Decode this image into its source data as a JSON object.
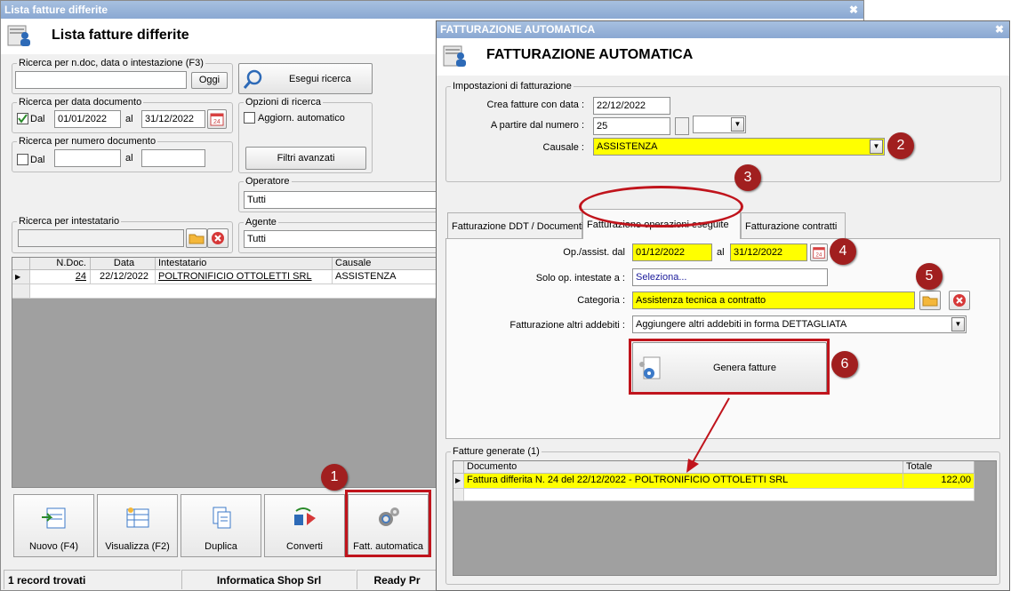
{
  "main": {
    "window_title": "Lista fatture differite",
    "page_title": "Lista fatture differite",
    "search_group": {
      "label": "Ricerca per n.doc, data o intestazione (F3)",
      "value": "",
      "ogg_label": "Oggi"
    },
    "search_button": "Esegui ricerca",
    "date_group": {
      "label": "Ricerca per data documento",
      "dal_label": "Dal",
      "from": "01/01/2022",
      "al_label": "al",
      "to": "31/12/2022",
      "checked": true
    },
    "number_group": {
      "label": "Ricerca per numero documento",
      "dal_label": "Dal",
      "al_label": "al",
      "from": "",
      "to": "",
      "checked": false
    },
    "options_group": {
      "label": "Opzioni di ricerca",
      "auto_update": "Aggiorn. automatico",
      "advanced_filters": "Filtri avanzati"
    },
    "operator": {
      "label": "Operatore",
      "value": "Tutti"
    },
    "agent": {
      "label": "Agente",
      "value": "Tutti"
    },
    "holder": {
      "label": "Ricerca per intestatario",
      "value": ""
    },
    "table": {
      "columns": [
        "N.Doc.",
        "Data",
        "Intestatario",
        "Causale"
      ],
      "rows": [
        {
          "ndoc": "24",
          "date": "22/12/2022",
          "holder": "POLTRONIFICIO OTTOLETTI SRL",
          "causale": "ASSISTENZA"
        }
      ]
    },
    "toolbar": {
      "new": "Nuovo (F4)",
      "view": "Visualizza (F2)",
      "duplicate": "Duplica",
      "convert": "Converti",
      "auto_invoice": "Fatt. automatica"
    },
    "status": {
      "records": "1 record trovati",
      "company": "Informatica Shop Srl",
      "ready": "Ready Pr"
    }
  },
  "dialog": {
    "window_title": "FATTURAZIONE AUTOMATICA",
    "page_title": "FATTURAZIONE AUTOMATICA",
    "settings_group": "Impostazioni di fatturazione",
    "create_date": {
      "label": "Crea fatture con data :",
      "value": "22/12/2022"
    },
    "start_number": {
      "label": "A partire dal numero :",
      "value": "25",
      "suffix": ""
    },
    "causale": {
      "label": "Causale :",
      "value": "ASSISTENZA"
    },
    "tabs": [
      {
        "label": "Fatturazione DDT / Documenti"
      },
      {
        "label": "Fatturazione operazioni eseguite"
      },
      {
        "label": "Fatturazione contratti"
      }
    ],
    "op_dates": {
      "label": "Op./assist. dal",
      "from": "01/12/2022",
      "al_label": "al",
      "to": "31/12/2022"
    },
    "op_holder": {
      "label": "Solo op. intestate a :",
      "value": "Seleziona..."
    },
    "category": {
      "label": "Categoria :",
      "value": "Assistenza tecnica a contratto"
    },
    "other_charges": {
      "label": "Fatturazione altri addebiti :",
      "value": "Aggiungere altri addebiti in forma DETTAGLIATA"
    },
    "generate_button": "Genera fatture",
    "generated": {
      "label": "Fatture generate (1)",
      "columns": [
        "Documento",
        "Totale"
      ],
      "rows": [
        {
          "document": "Fattura differita N. 24 del 22/12/2022 - POLTRONIFICIO OTTOLETTI SRL",
          "total": "122,00"
        }
      ]
    }
  },
  "callouts": [
    "1",
    "2",
    "3",
    "4",
    "5",
    "6"
  ],
  "colors": {
    "highlight": "#ffff00",
    "callout": "#a11f1f",
    "titlebar": "#8aa8d2"
  }
}
